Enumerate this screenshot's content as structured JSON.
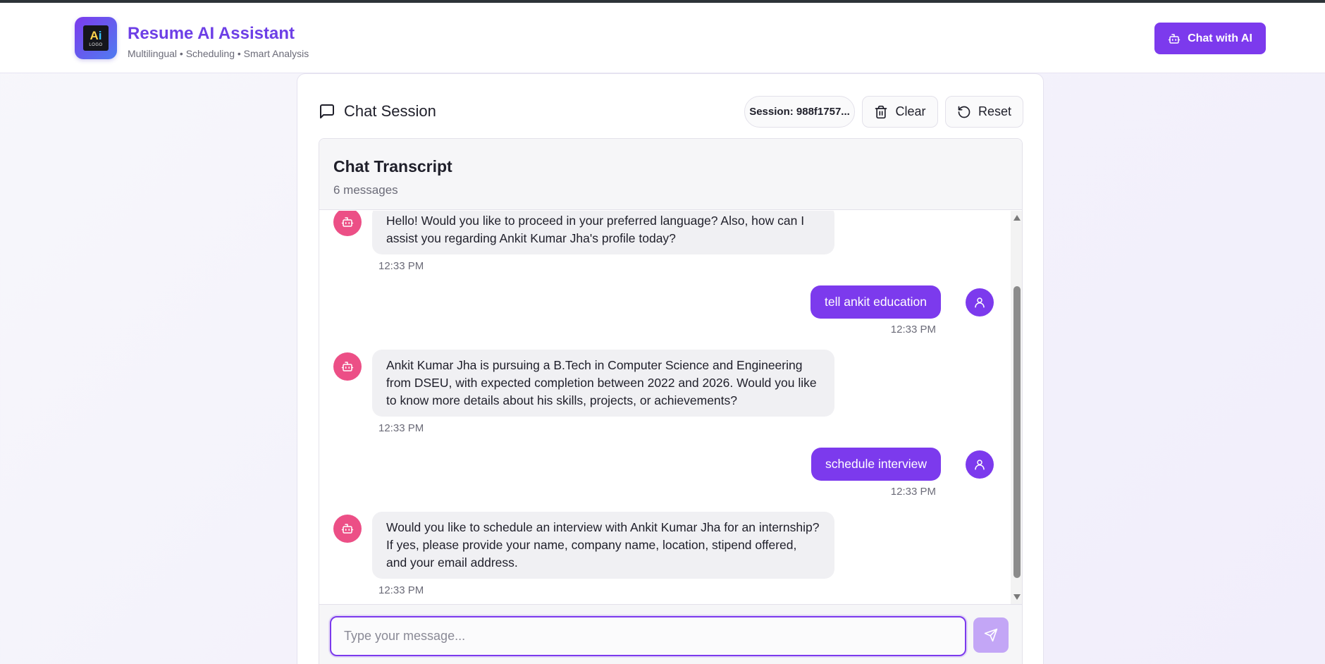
{
  "header": {
    "logo": {
      "text_ai_a": "A",
      "text_ai_i": "i",
      "text_sub": "LOGO"
    },
    "title": "Resume AI Assistant",
    "subtitle": "Multilingual • Scheduling • Smart Analysis",
    "chat_button_label": "Chat with AI"
  },
  "session": {
    "title": "Chat Session",
    "session_label": "Session: 988f1757...",
    "clear_label": "Clear",
    "reset_label": "Reset"
  },
  "transcript": {
    "title": "Chat Transcript",
    "count": "6 messages",
    "messages": [
      {
        "role": "bot",
        "text": "Hello! Would you like to proceed in your preferred language? Also, how can I assist you regarding Ankit Kumar Jha's profile today?",
        "time": "12:33 PM"
      },
      {
        "role": "user",
        "text": "tell ankit education",
        "time": "12:33 PM"
      },
      {
        "role": "bot",
        "text": "Ankit Kumar Jha is pursuing a B.Tech in Computer Science and Engineering from DSEU, with expected completion between 2022 and 2026. Would you like to know more details about his skills, projects, or achievements?",
        "time": "12:33 PM"
      },
      {
        "role": "user",
        "text": "schedule interview",
        "time": "12:33 PM"
      },
      {
        "role": "bot",
        "text": "Would you like to schedule an interview with Ankit Kumar Jha for an internship? If yes, please provide your name, company name, location, stipend offered, and your email address.",
        "time": "12:33 PM"
      }
    ]
  },
  "input": {
    "placeholder": "Type your message...",
    "value": ""
  },
  "icons": {
    "logo": "logo-icon",
    "chat_with_ai": "bot-icon",
    "session": "message-square-icon",
    "clear": "trash-icon",
    "reset": "rotate-ccw-icon",
    "bot_avatar": "bot-icon",
    "user_avatar": "user-icon",
    "send": "send-icon"
  },
  "colors": {
    "accent": "#7c3aed",
    "bot_avatar": "#ec4f86",
    "send_disabled": "#c3a6f6",
    "bubble_bot": "#f0f0f3"
  }
}
